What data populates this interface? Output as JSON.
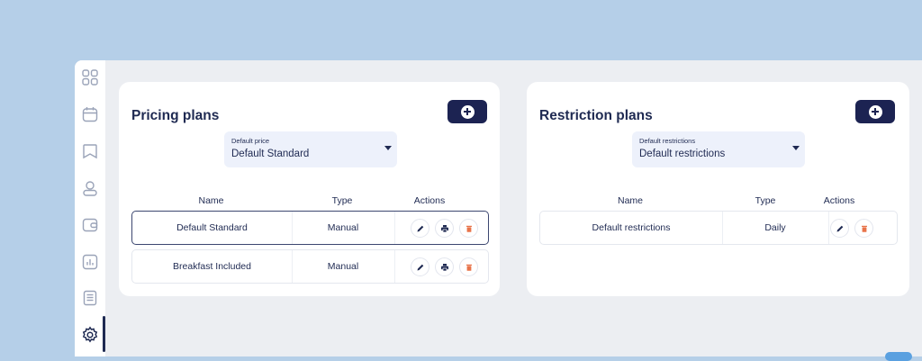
{
  "sidebar": {
    "items": [
      {
        "name": "dashboard-icon"
      },
      {
        "name": "calendar-icon"
      },
      {
        "name": "bookmark-icon"
      },
      {
        "name": "user-icon"
      },
      {
        "name": "wallet-icon"
      },
      {
        "name": "chart-icon"
      },
      {
        "name": "document-icon"
      },
      {
        "name": "settings-icon",
        "active": true
      }
    ]
  },
  "pricing": {
    "title": "Pricing plans",
    "select_label": "Default price",
    "select_value": "Default Standard",
    "columns": {
      "name": "Name",
      "type": "Type",
      "actions": "Actions"
    },
    "rows": [
      {
        "name": "Default Standard",
        "type": "Manual",
        "selected": true
      },
      {
        "name": "Breakfast Included",
        "type": "Manual"
      }
    ]
  },
  "restriction": {
    "title": "Restriction plans",
    "select_label": "Default restrictions",
    "select_value": "Default restrictions",
    "columns": {
      "name": "Name",
      "type": "Type",
      "actions": "Actions"
    },
    "rows": [
      {
        "name": "Default restrictions",
        "type": "Daily"
      }
    ]
  },
  "colors": {
    "accent": "#1c2352",
    "delete": "#e8734a",
    "background": "#b5cfe8"
  }
}
